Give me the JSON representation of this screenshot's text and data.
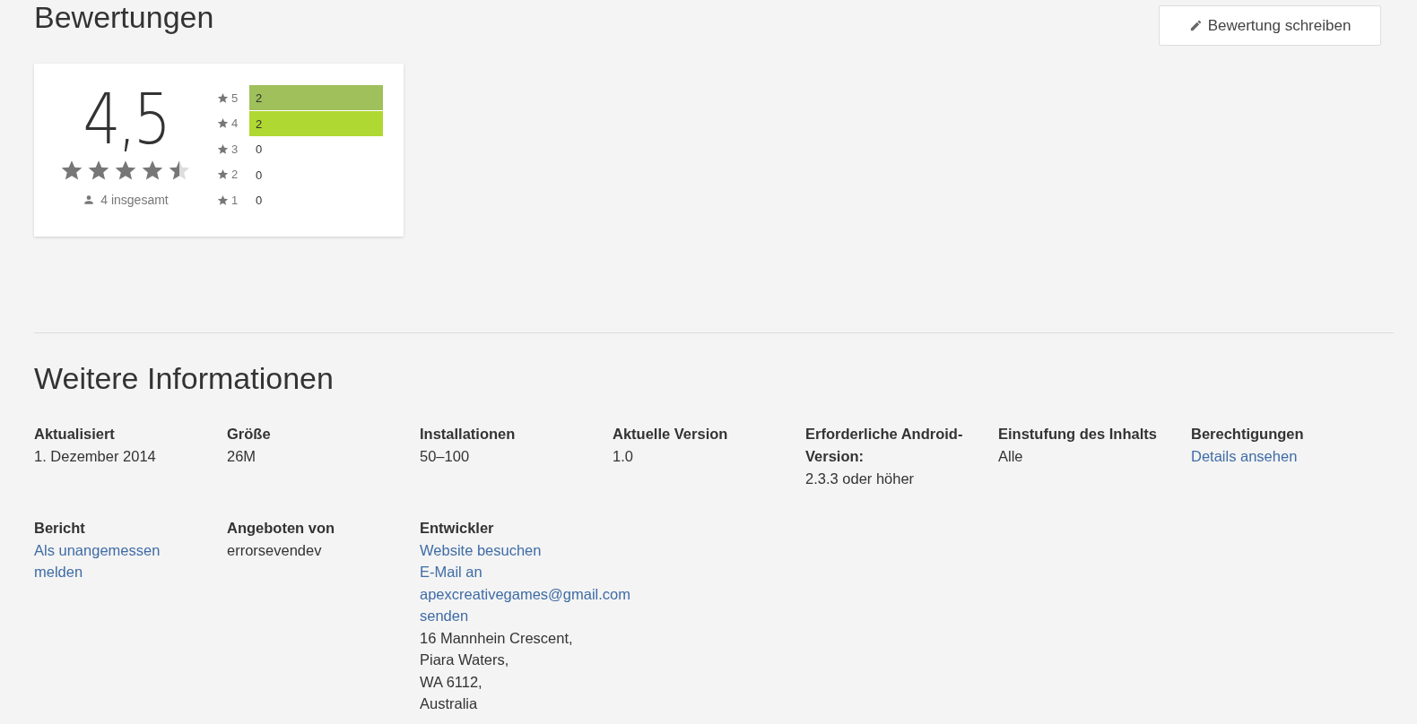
{
  "ratings": {
    "title": "Bewertungen",
    "write_button": "Bewertung schreiben",
    "score": "4,5",
    "stars": 4.5,
    "total": "4 insgesamt",
    "histogram": [
      {
        "label": "5",
        "count": "2",
        "color": "#9fc05a"
      },
      {
        "label": "4",
        "count": "2",
        "color": "#b0d832"
      },
      {
        "label": "3",
        "count": "0"
      },
      {
        "label": "2",
        "count": "0"
      },
      {
        "label": "1",
        "count": "0"
      }
    ]
  },
  "info": {
    "title": "Weitere Informationen",
    "rows": [
      [
        {
          "label": "Aktualisiert",
          "values": [
            {
              "kind": "text",
              "text": "1. Dezember 2014"
            }
          ]
        },
        {
          "label": "Größe",
          "values": [
            {
              "kind": "text",
              "text": "26M"
            }
          ]
        },
        {
          "label": "Installationen",
          "values": [
            {
              "kind": "text",
              "text": "50–100"
            }
          ]
        },
        {
          "label": "Aktuelle Version",
          "values": [
            {
              "kind": "text",
              "text": "1.0"
            }
          ]
        },
        {
          "label": "Erforderliche Android-Version:",
          "values": [
            {
              "kind": "text",
              "text": "2.3.3 oder höher"
            }
          ]
        },
        {
          "label": "Einstufung des Inhalts",
          "values": [
            {
              "kind": "text",
              "text": "Alle"
            }
          ]
        },
        {
          "label": "Berechtigungen",
          "values": [
            {
              "kind": "link",
              "text": "Details ansehen"
            }
          ]
        }
      ],
      [
        {
          "label": "Bericht",
          "values": [
            {
              "kind": "link",
              "text": "Als unangemessen melden"
            }
          ]
        },
        {
          "label": "Angeboten von",
          "values": [
            {
              "kind": "text",
              "text": "errorsevendev"
            }
          ]
        },
        {
          "label": "Entwickler",
          "values": [
            {
              "kind": "link",
              "text": "Website besuchen"
            },
            {
              "kind": "link",
              "text": "E-Mail an apexcreativegames@gmail.com senden"
            },
            {
              "kind": "text",
              "text": "16 Mannhein Crescent,"
            },
            {
              "kind": "text",
              "text": "Piara Waters,"
            },
            {
              "kind": "text",
              "text": "WA 6112,"
            },
            {
              "kind": "text",
              "text": "Australia"
            }
          ]
        }
      ]
    ]
  }
}
